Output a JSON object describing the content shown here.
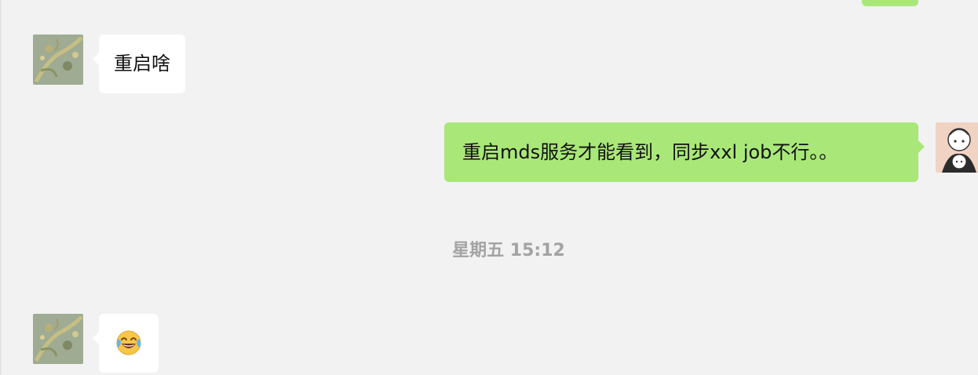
{
  "chat": {
    "messages": [
      {
        "direction": "incoming",
        "text": "重启啥"
      },
      {
        "direction": "outgoing",
        "text": "重启mds服务才能看到，同步xxl job不行。。"
      },
      {
        "direction": "incoming",
        "emoji": "face-with-tears-of-joy-icon"
      }
    ],
    "timestamp": "星期五 15:12"
  },
  "colors": {
    "background": "#f2f2f2",
    "incoming_bubble": "#ffffff",
    "outgoing_bubble": "#a9e878",
    "timestamp_text": "#a3a3a3"
  }
}
